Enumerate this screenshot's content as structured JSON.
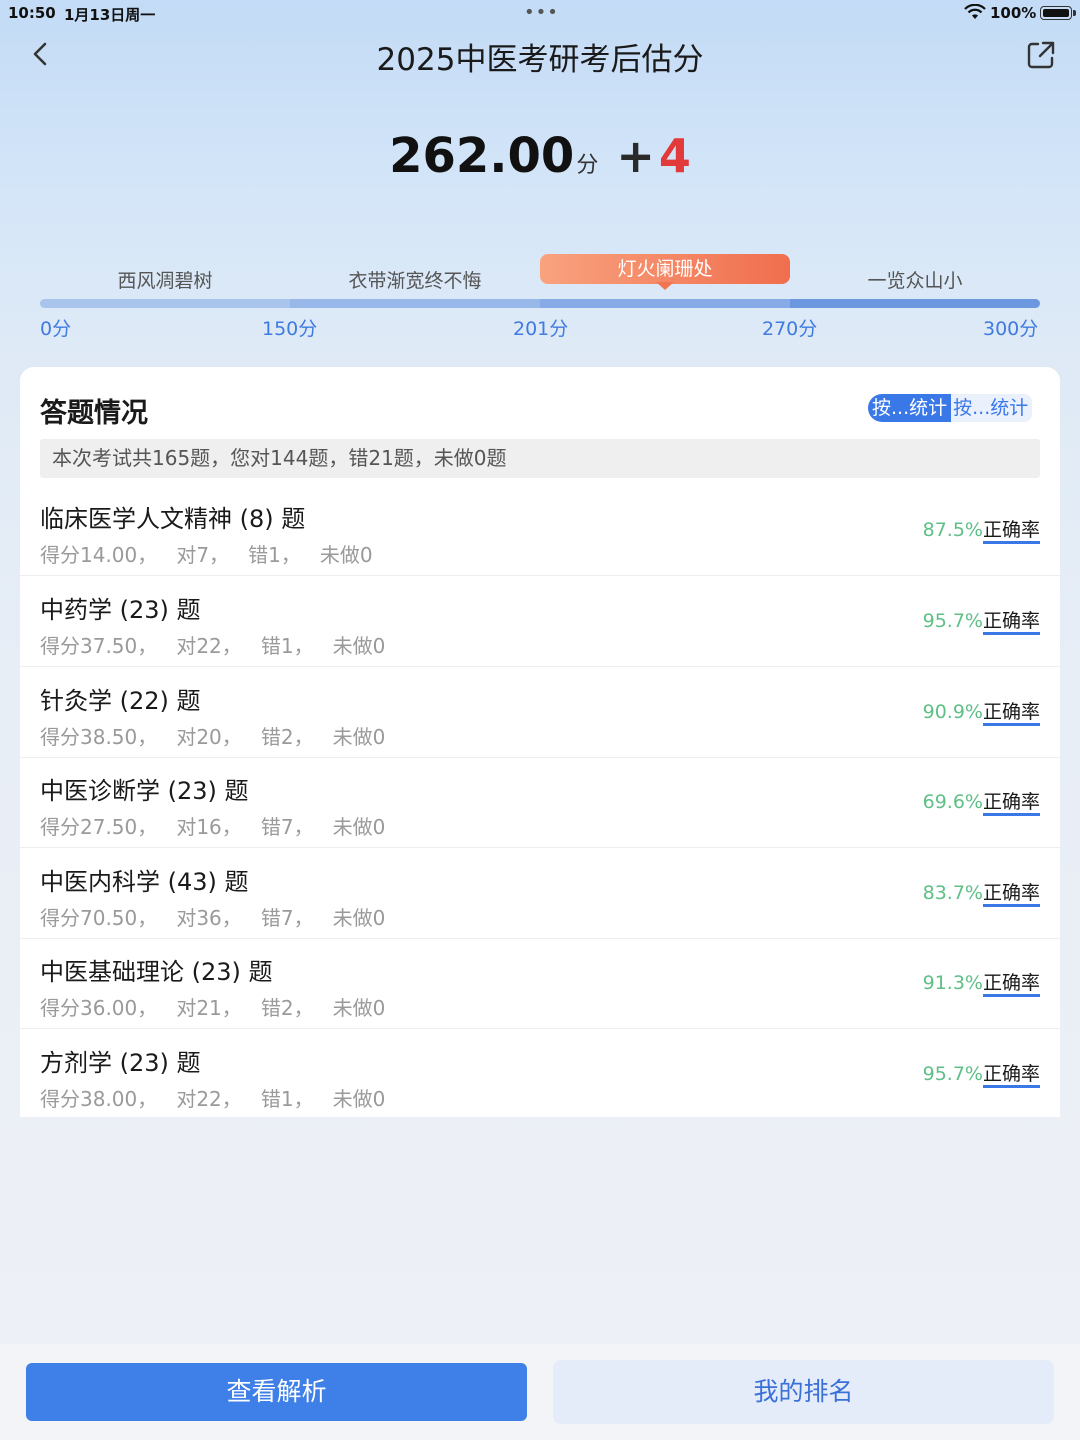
{
  "status_bar": {
    "time": "10:50",
    "date": "1月13日周一",
    "battery": "100%"
  },
  "header": {
    "title": "2025中医考研考后估分"
  },
  "score": {
    "value": "262.00",
    "unit": "分",
    "plus": "+",
    "delta": "4"
  },
  "levels": {
    "labels": [
      "西风凋碧树",
      "衣带渐宽终不悔",
      "灯火阑珊处",
      "一览众山小"
    ],
    "active_index": 2,
    "ticks": [
      "0分",
      "150分",
      "201分",
      "270分",
      "300分"
    ]
  },
  "answer_section": {
    "title": "答题情况",
    "toggle_active": "按...统计",
    "toggle_inactive": "按...统计",
    "summary": "本次考试共165题，您对144题，错21题，未做0题",
    "rate_label": "正确率",
    "subjects": [
      {
        "name": "临床医学人文精神 (8) 题",
        "stats": "得分14.00，   对7，   错1，   未做0",
        "rate": "87.5%"
      },
      {
        "name": "中药学 (23) 题",
        "stats": "得分37.50，   对22，   错1，   未做0",
        "rate": "95.7%"
      },
      {
        "name": "针灸学 (22) 题",
        "stats": "得分38.50，   对20，   错2，   未做0",
        "rate": "90.9%"
      },
      {
        "name": "中医诊断学 (23) 题",
        "stats": "得分27.50，   对16，   错7，   未做0",
        "rate": "69.6%"
      },
      {
        "name": "中医内科学 (43) 题",
        "stats": "得分70.50，   对36，   错7，   未做0",
        "rate": "83.7%"
      },
      {
        "name": "中医基础理论 (23) 题",
        "stats": "得分36.00，   对21，   错2，   未做0",
        "rate": "91.3%"
      },
      {
        "name": "方剂学 (23) 题",
        "stats": "得分38.00，   对22，   错1，   未做0",
        "rate": "95.7%"
      }
    ]
  },
  "footer": {
    "view_analysis": "查看解析",
    "my_ranking": "我的排名"
  },
  "colors": {
    "accent": "#3f7fe8",
    "delta_red": "#e23a3a",
    "rate_green": "#5fbf86",
    "active_level": "#f27552"
  }
}
